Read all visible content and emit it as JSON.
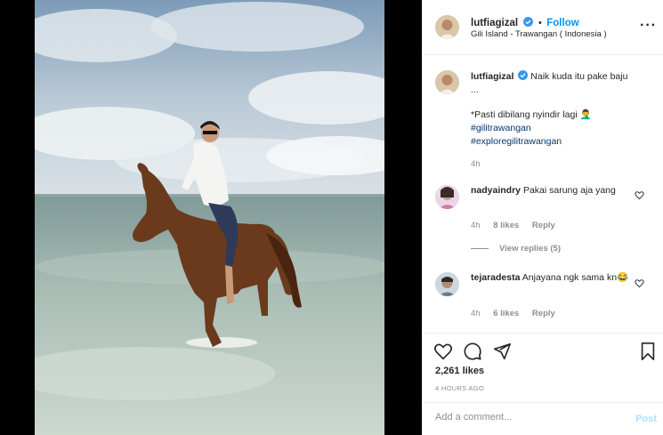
{
  "photo": {
    "description_icon": "horse-rider-beach-photo"
  },
  "header": {
    "username": "lutfiagizal",
    "follow_separator": "•",
    "follow_label": "Follow",
    "location": "Gili Island - Trawangan ( Indonesia )",
    "more_icon": "more-options-icon",
    "more_glyph": "···"
  },
  "caption": {
    "username": "lutfiagizal",
    "text": "Naik kuda itu pake baju ...",
    "line2": "*Pasti dibilang nyindir lagi 🤦‍♂️",
    "hashtag1": "#gilitrawangan",
    "hashtag2": "#exploregilitrawangan",
    "time": "4h"
  },
  "comments": [
    {
      "username": "nadyaindry",
      "text": "Pakai sarung aja yang",
      "time": "4h",
      "likes": "8 likes",
      "reply": "Reply"
    },
    {
      "username": "tejaradesta",
      "text": "Anjayana ngk sama kn😂",
      "time": "4h",
      "likes": "6 likes",
      "reply": "Reply"
    }
  ],
  "view_replies": "View replies (5)",
  "likes_count": "2,261 likes",
  "posted_time": "4 HOURS AGO",
  "add_comment_placeholder": "Add a comment...",
  "post_label": "Post",
  "colors": {
    "accent": "#0095f6",
    "hashtag": "#00376b",
    "muted": "#8e8e8e",
    "verified": "#3897f0"
  }
}
